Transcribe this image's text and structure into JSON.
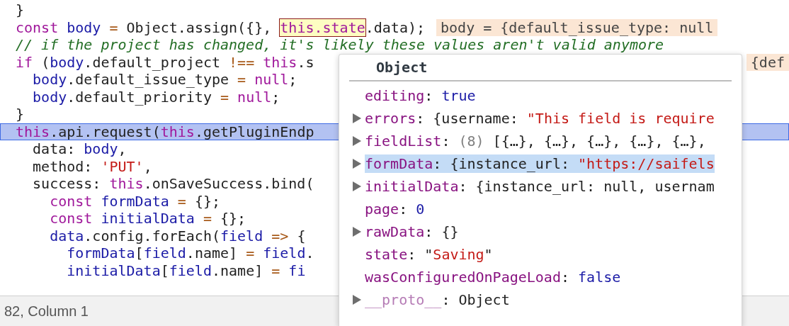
{
  "code_lines": [
    {
      "highlighted": false,
      "tokens": [
        {
          "text": "}",
          "kind": "plain"
        }
      ]
    },
    {
      "highlighted": false,
      "tokens": [
        {
          "text": "const ",
          "kind": "kw"
        },
        {
          "text": "body",
          "kind": "var"
        },
        {
          "text": " = ",
          "kind": "op"
        },
        {
          "text": "Object.assign({}, ",
          "kind": "plain"
        },
        {
          "text": "this.state",
          "kind": "kw",
          "hovered": true
        },
        {
          "text": ".data);",
          "kind": "plain"
        }
      ],
      "inline_value": "body = {default_issue_type: null"
    },
    {
      "highlighted": false,
      "tokens": [
        {
          "text": "// if the project has changed, it's likely these values aren't valid anymore",
          "kind": "comment"
        }
      ]
    },
    {
      "highlighted": false,
      "tokens": [
        {
          "text": "if",
          "kind": "kw"
        },
        {
          "text": " (",
          "kind": "plain"
        },
        {
          "text": "body",
          "kind": "var"
        },
        {
          "text": ".default_project ",
          "kind": "plain"
        },
        {
          "text": "!== ",
          "kind": "op"
        },
        {
          "text": "this",
          "kind": "kw"
        },
        {
          "text": ".s",
          "kind": "plain"
        }
      ],
      "inline_value": "{def"
    },
    {
      "highlighted": false,
      "tokens": [
        {
          "text": "  body",
          "kind": "var"
        },
        {
          "text": ".default_issue_type ",
          "kind": "plain"
        },
        {
          "text": "= ",
          "kind": "op"
        },
        {
          "text": "null",
          "kind": "kw"
        },
        {
          "text": ";",
          "kind": "plain"
        }
      ]
    },
    {
      "highlighted": false,
      "tokens": [
        {
          "text": "  body",
          "kind": "var"
        },
        {
          "text": ".default_priority ",
          "kind": "plain"
        },
        {
          "text": "= ",
          "kind": "op"
        },
        {
          "text": "null",
          "kind": "kw"
        },
        {
          "text": ";",
          "kind": "plain"
        }
      ]
    },
    {
      "highlighted": false,
      "tokens": [
        {
          "text": "}",
          "kind": "plain"
        }
      ]
    },
    {
      "highlighted": true,
      "tokens": [
        {
          "text": "this",
          "kind": "kw"
        },
        {
          "text": ".api.request(",
          "kind": "plain"
        },
        {
          "text": "this",
          "kind": "kw"
        },
        {
          "text": ".getPluginEndp",
          "kind": "plain"
        }
      ]
    },
    {
      "highlighted": false,
      "tokens": [
        {
          "text": "  data: ",
          "kind": "plain"
        },
        {
          "text": "body",
          "kind": "var"
        },
        {
          "text": ",",
          "kind": "plain"
        }
      ]
    },
    {
      "highlighted": false,
      "tokens": [
        {
          "text": "  method: ",
          "kind": "plain"
        },
        {
          "text": "'PUT'",
          "kind": "str"
        },
        {
          "text": ",",
          "kind": "plain"
        }
      ]
    },
    {
      "highlighted": false,
      "tokens": [
        {
          "text": "  success: ",
          "kind": "plain"
        },
        {
          "text": "this",
          "kind": "kw"
        },
        {
          "text": ".onSaveSuccess.bind(",
          "kind": "plain"
        }
      ]
    },
    {
      "highlighted": false,
      "tokens": [
        {
          "text": "    const ",
          "kind": "kw"
        },
        {
          "text": "formData",
          "kind": "var"
        },
        {
          "text": " = ",
          "kind": "op"
        },
        {
          "text": "{};",
          "kind": "plain"
        }
      ]
    },
    {
      "highlighted": false,
      "tokens": [
        {
          "text": "    const ",
          "kind": "kw"
        },
        {
          "text": "initialData",
          "kind": "var"
        },
        {
          "text": " = ",
          "kind": "op"
        },
        {
          "text": "{};",
          "kind": "plain"
        }
      ]
    },
    {
      "highlighted": false,
      "tokens": [
        {
          "text": "    data",
          "kind": "var"
        },
        {
          "text": ".config.forEach(",
          "kind": "plain"
        },
        {
          "text": "field",
          "kind": "var"
        },
        {
          "text": " => ",
          "kind": "op"
        },
        {
          "text": "{",
          "kind": "plain"
        }
      ]
    },
    {
      "highlighted": false,
      "tokens": [
        {
          "text": "      formData",
          "kind": "var"
        },
        {
          "text": "[",
          "kind": "plain"
        },
        {
          "text": "field",
          "kind": "var"
        },
        {
          "text": ".name] ",
          "kind": "plain"
        },
        {
          "text": "= ",
          "kind": "op"
        },
        {
          "text": "field",
          "kind": "var"
        },
        {
          "text": ".",
          "kind": "plain"
        }
      ]
    },
    {
      "highlighted": false,
      "tokens": [
        {
          "text": "      initialData",
          "kind": "var"
        },
        {
          "text": "[",
          "kind": "plain"
        },
        {
          "text": "field",
          "kind": "var"
        },
        {
          "text": ".name] ",
          "kind": "plain"
        },
        {
          "text": "= ",
          "kind": "op"
        },
        {
          "text": "fi",
          "kind": "var"
        }
      ]
    }
  ],
  "status_bar": "82, Column 1",
  "popup": {
    "title": "Object",
    "entries": [
      {
        "key": "editing",
        "expandable": false,
        "selected": false,
        "inherited": false,
        "value": [
          {
            "text": ": ",
            "kind": "plain"
          },
          {
            "text": "true",
            "kind": "lit"
          }
        ]
      },
      {
        "key": "errors",
        "expandable": true,
        "selected": false,
        "inherited": false,
        "value": [
          {
            "text": ": {username: ",
            "kind": "plain"
          },
          {
            "text": "\"This field is require",
            "kind": "str"
          }
        ]
      },
      {
        "key": "fieldList",
        "expandable": true,
        "selected": false,
        "inherited": false,
        "value": [
          {
            "text": ": ",
            "kind": "plain"
          },
          {
            "text": "(8) ",
            "kind": "dim"
          },
          {
            "text": "[{…}, {…}, {…}, {…}, {…}, ",
            "kind": "plain"
          }
        ]
      },
      {
        "key": "formData",
        "expandable": true,
        "selected": true,
        "inherited": false,
        "value": [
          {
            "text": ": {instance_url: ",
            "kind": "plain"
          },
          {
            "text": "\"https://saifels",
            "kind": "str"
          }
        ]
      },
      {
        "key": "initialData",
        "expandable": true,
        "selected": false,
        "inherited": false,
        "value": [
          {
            "text": ": {instance_url: null, usernam",
            "kind": "plain"
          }
        ]
      },
      {
        "key": "page",
        "expandable": false,
        "selected": false,
        "inherited": false,
        "value": [
          {
            "text": ": ",
            "kind": "plain"
          },
          {
            "text": "0",
            "kind": "lit"
          }
        ]
      },
      {
        "key": "rawData",
        "expandable": true,
        "selected": false,
        "inherited": false,
        "value": [
          {
            "text": ": {}",
            "kind": "plain"
          }
        ]
      },
      {
        "key": "state",
        "expandable": false,
        "selected": false,
        "inherited": false,
        "value": [
          {
            "text": ": \"",
            "kind": "plain"
          },
          {
            "text": "Saving",
            "kind": "str"
          },
          {
            "text": "\"",
            "kind": "plain"
          }
        ]
      },
      {
        "key": "wasConfiguredOnPageLoad",
        "expandable": false,
        "selected": false,
        "inherited": false,
        "value": [
          {
            "text": ": ",
            "kind": "plain"
          },
          {
            "text": "false",
            "kind": "lit"
          }
        ]
      },
      {
        "key": "__proto__",
        "expandable": true,
        "selected": false,
        "inherited": true,
        "value": [
          {
            "text": ": Object",
            "kind": "plain"
          }
        ]
      }
    ]
  }
}
